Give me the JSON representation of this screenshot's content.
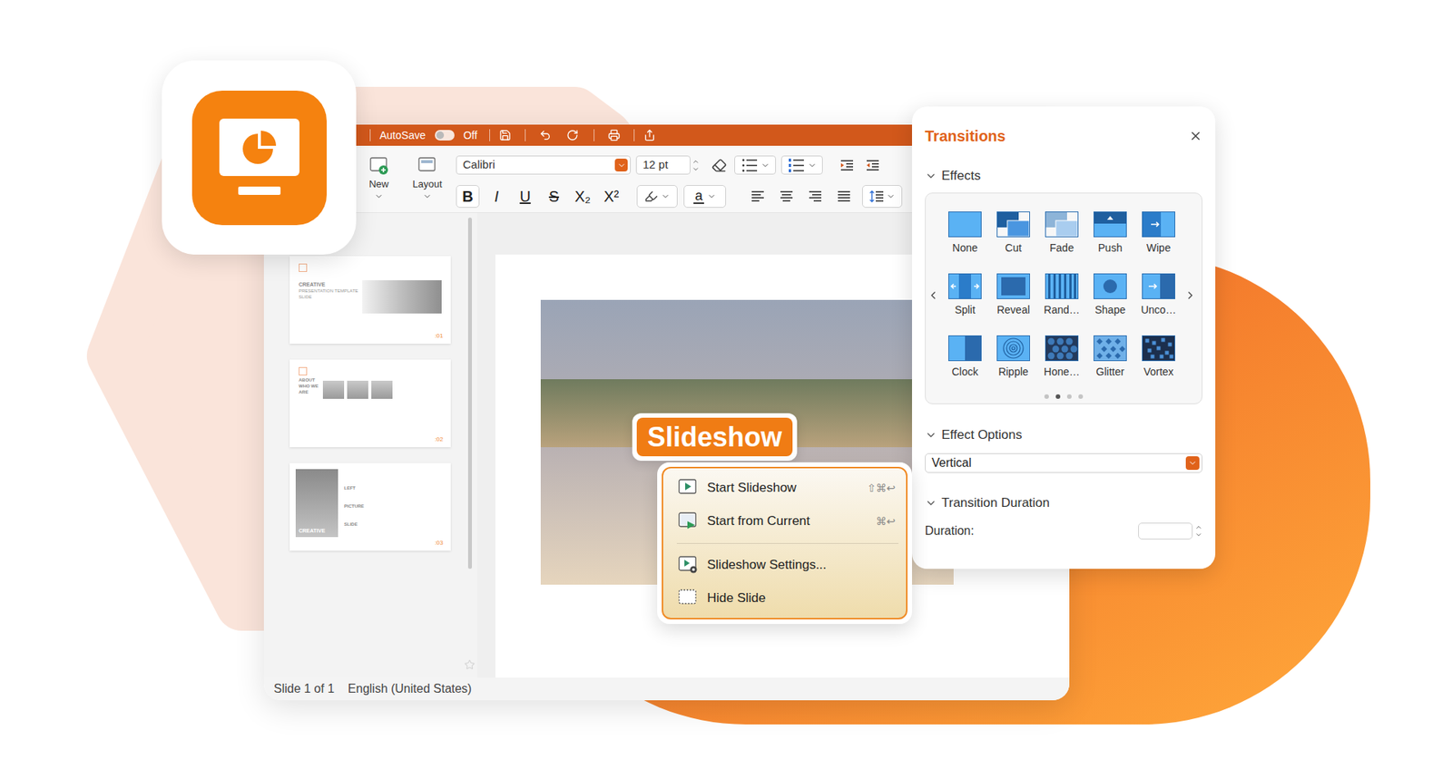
{
  "window": {
    "title_bar": {
      "autosave": {
        "label": "AutoSave",
        "on": false,
        "state": "Off"
      }
    },
    "toolbar": {
      "buttons": [
        {
          "label": "New",
          "kind": "new"
        },
        {
          "label": "Layout",
          "kind": "layout"
        }
      ],
      "font": "Calibri",
      "size": "12 pt",
      "format": [
        {
          "label": "B",
          "kind": "bold",
          "selected": true
        },
        {
          "label": "I",
          "kind": "italic",
          "selected": false
        },
        {
          "label": "U",
          "kind": "underline",
          "selected": false
        },
        {
          "label": "S",
          "kind": "strike",
          "selected": false
        },
        {
          "label": "X₂",
          "kind": "sub",
          "selected": false
        },
        {
          "label": "X²",
          "kind": "sup",
          "selected": false
        }
      ],
      "font_color": "a"
    },
    "slides": [
      {
        "kind": "title",
        "title": "CREATIVE",
        "subtitle": "PRESENTATION TEMPLATE SLIDE",
        "number": ":01"
      },
      {
        "kind": "about",
        "title": "ABOUT WHO WE ARE",
        "number": ":02"
      },
      {
        "kind": "picture",
        "title": "LEFT PICTURE SLIDE",
        "overlay": "CREATIVE",
        "number": ":03"
      }
    ],
    "status_bar": {
      "position": "Slide 1 of 1",
      "language": "English (United States)"
    }
  },
  "badge": {
    "label": "Slideshow"
  },
  "menu": {
    "items": [
      {
        "label": "Start Slideshow",
        "shortcut": "⇧⌘↩",
        "kind": "start",
        "separator_before": false
      },
      {
        "label": "Start from Current",
        "shortcut": "⌘↩",
        "kind": "current",
        "separator_before": false
      },
      {
        "label": "Slideshow Settings...",
        "shortcut": "",
        "kind": "settings",
        "separator_before": true
      },
      {
        "label": "Hide Slide",
        "shortcut": "",
        "kind": "hide",
        "separator_before": false
      }
    ]
  },
  "transitions": {
    "title": "Transitions",
    "effects_section": {
      "label": "Effects",
      "expanded": true
    },
    "effects": [
      {
        "label": "None",
        "kind": "none"
      },
      {
        "label": "Cut",
        "kind": "cut"
      },
      {
        "label": "Fade",
        "kind": "fade"
      },
      {
        "label": "Push",
        "kind": "push"
      },
      {
        "label": "Wipe",
        "kind": "wipe"
      },
      {
        "label": "Split",
        "kind": "split"
      },
      {
        "label": "Reveal",
        "kind": "reveal"
      },
      {
        "label": "Rand…",
        "kind": "random"
      },
      {
        "label": "Shape",
        "kind": "shape"
      },
      {
        "label": "Unco…",
        "kind": "uncover"
      },
      {
        "label": "Clock",
        "kind": "clock"
      },
      {
        "label": "Ripple",
        "kind": "ripple"
      },
      {
        "label": "Hone…",
        "kind": "honeycomb"
      },
      {
        "label": "Glitter",
        "kind": "glitter"
      },
      {
        "label": "Vortex",
        "kind": "vortex"
      }
    ],
    "pages": [
      {
        "selected": false
      },
      {
        "selected": true
      },
      {
        "selected": false
      },
      {
        "selected": false
      }
    ],
    "options_section": {
      "label": "Effect Options",
      "expanded": true
    },
    "option": "Vertical",
    "duration_section": {
      "label": "Transition Duration",
      "expanded": true
    },
    "duration_label": "Duration:",
    "duration": ""
  }
}
